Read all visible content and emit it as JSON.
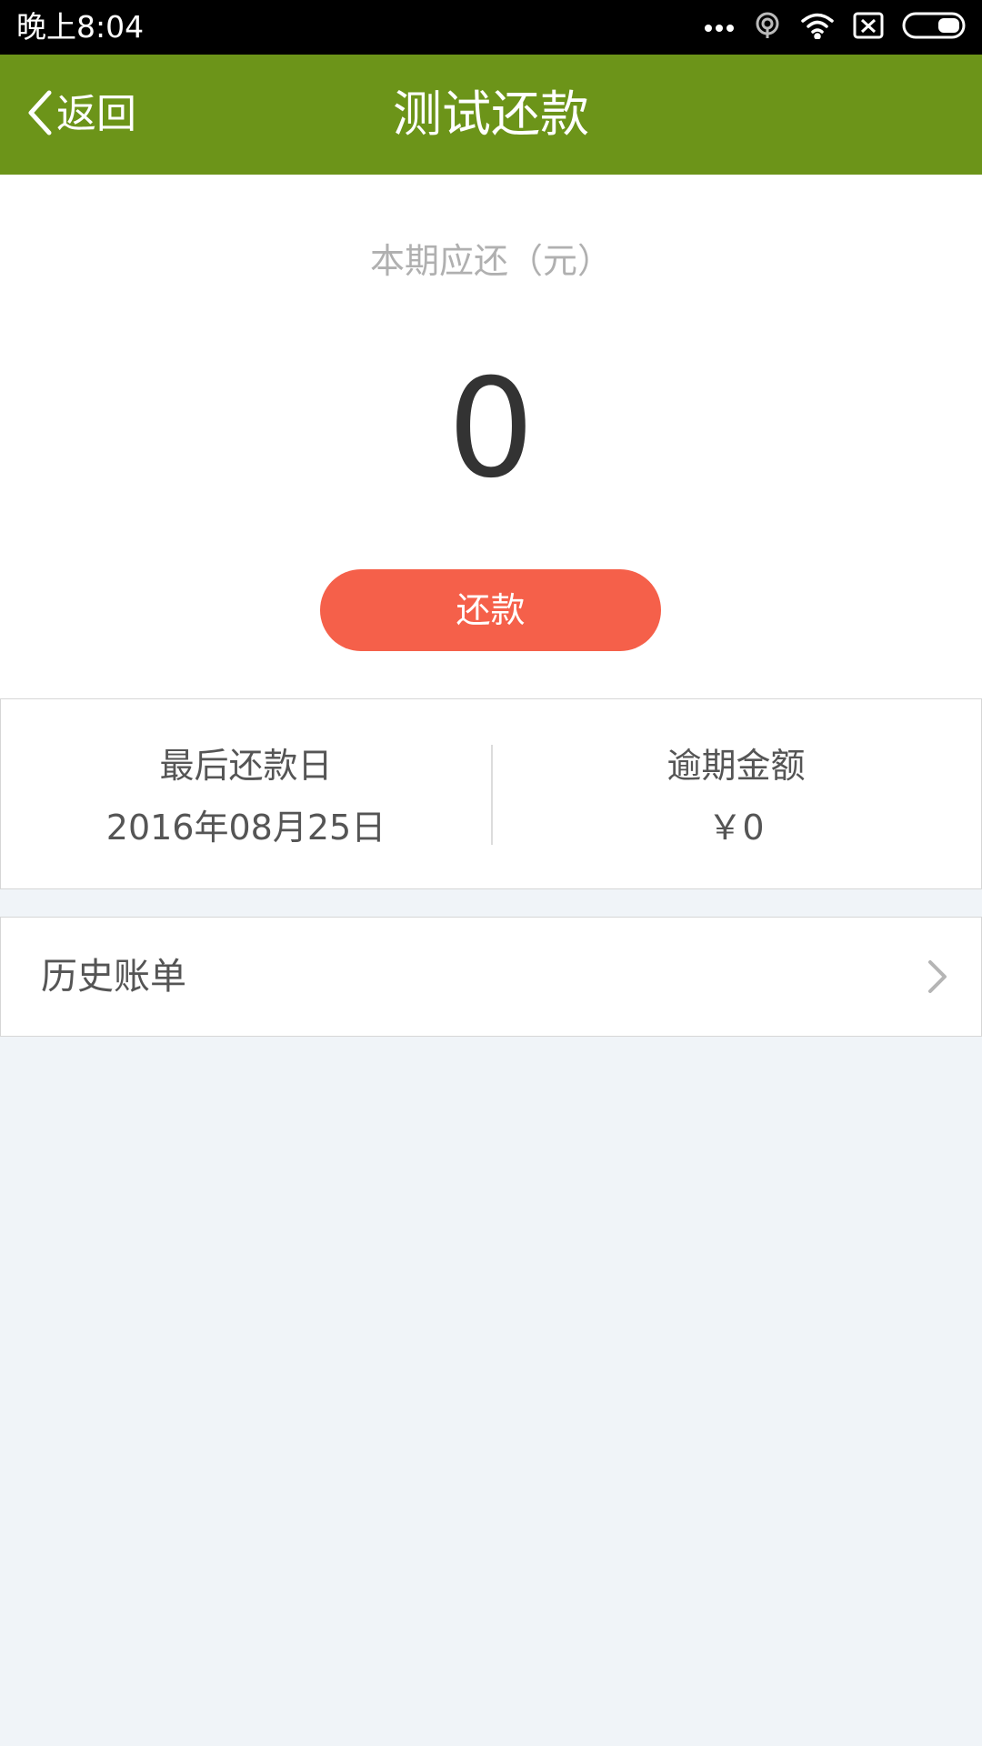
{
  "status_bar": {
    "time": "晚上8:04",
    "icons": [
      "more-dots-icon",
      "hotspot-icon",
      "wifi-icon",
      "sim-off-icon",
      "battery-icon"
    ]
  },
  "nav": {
    "back_label": "返回",
    "title": "测试还款"
  },
  "summary": {
    "amount_label": "本期应还（元）",
    "amount_value": "0",
    "repay_button": "还款"
  },
  "info": {
    "due_title": "最后还款日",
    "due_value": "2016年08月25日",
    "overdue_title": "逾期金额",
    "overdue_value": "￥0"
  },
  "history": {
    "label": "历史账单"
  },
  "colors": {
    "nav_bg": "#6c9419",
    "button_bg": "#f5604a",
    "page_bg": "#f0f4f8"
  }
}
